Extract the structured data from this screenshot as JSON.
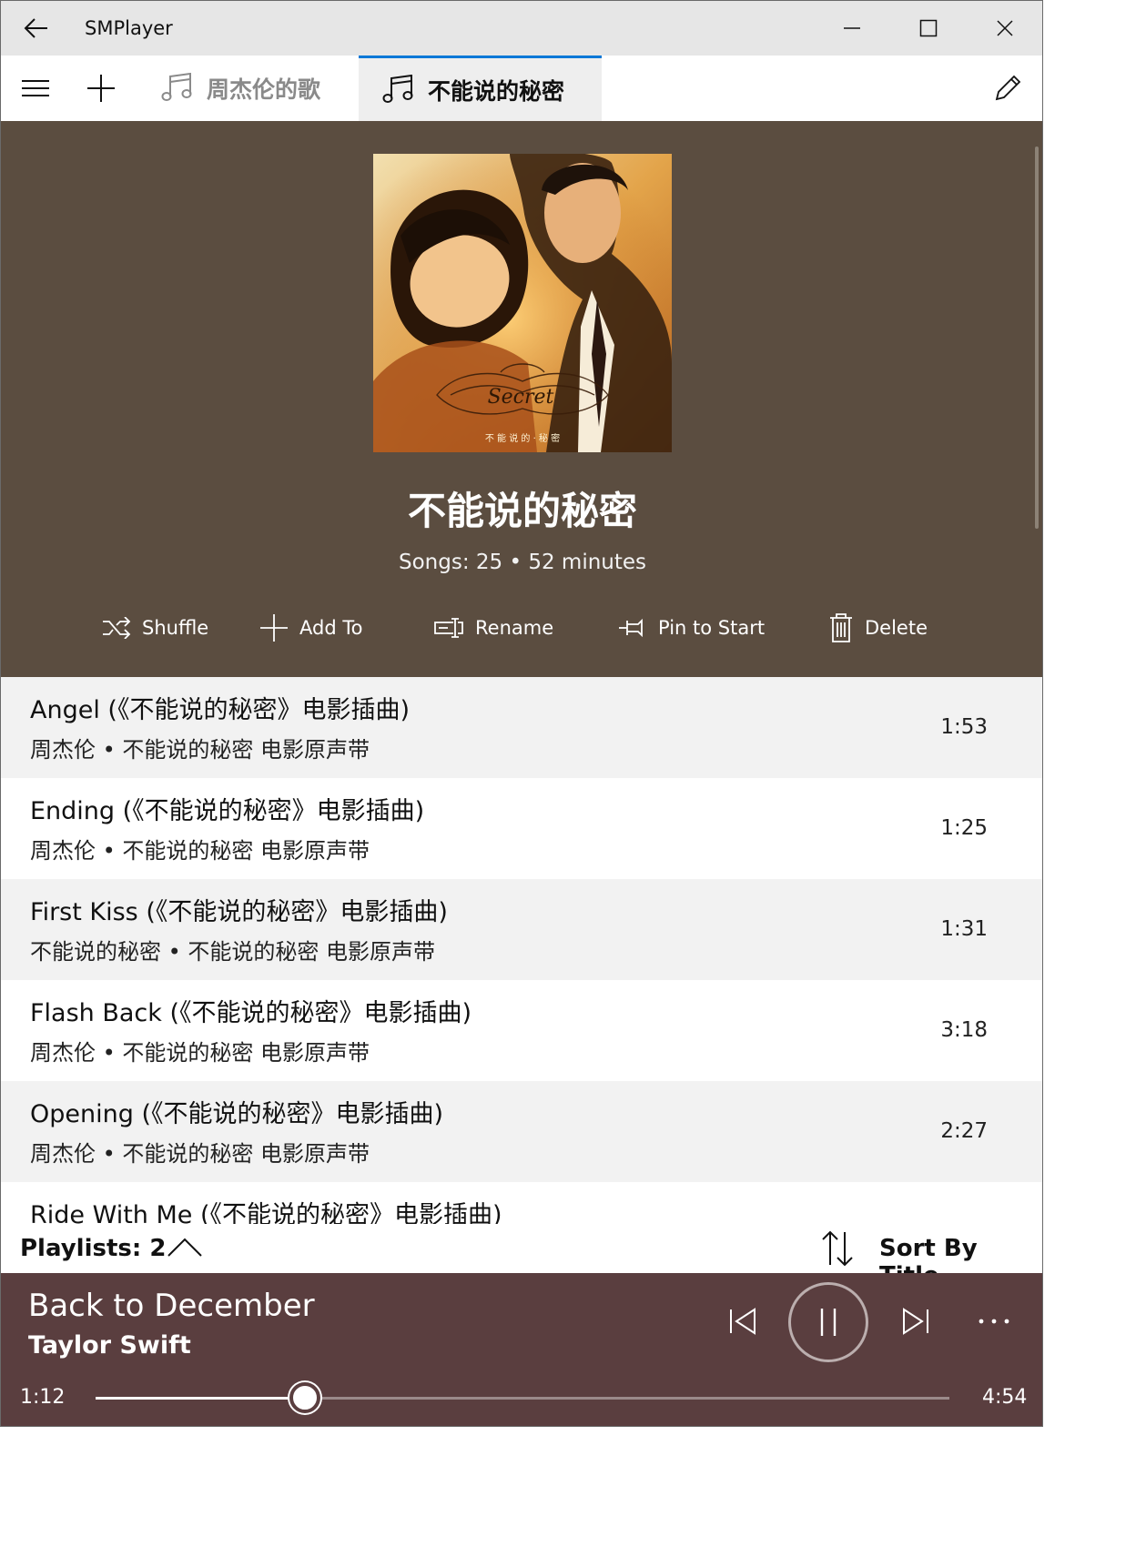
{
  "window": {
    "title": "SMPlayer"
  },
  "tabs": [
    {
      "label": "周杰伦的歌",
      "active": false
    },
    {
      "label": "不能说的秘密",
      "active": true
    }
  ],
  "playlist": {
    "title": "不能说的秘密",
    "meta": "Songs: 25 • 52 minutes",
    "album_art_text": {
      "script": "Secret",
      "caption": "不 能 说 的 · 秘 密"
    },
    "actions": [
      {
        "label": "Shuffle",
        "icon": "shuffle-icon"
      },
      {
        "label": "Add To",
        "icon": "plus-icon"
      },
      {
        "label": "Rename",
        "icon": "rename-icon"
      },
      {
        "label": "Pin to Start",
        "icon": "pin-icon"
      },
      {
        "label": "Delete",
        "icon": "trash-icon"
      }
    ]
  },
  "songs": [
    {
      "title": "Angel (《不能说的秘密》电影插曲)",
      "subtitle": "周杰伦 • 不能说的秘密 电影原声带",
      "duration": "1:53"
    },
    {
      "title": "Ending (《不能说的秘密》电影插曲)",
      "subtitle": "周杰伦 • 不能说的秘密 电影原声带",
      "duration": "1:25"
    },
    {
      "title": "First Kiss (《不能说的秘密》电影插曲)",
      "subtitle": "不能说的秘密 • 不能说的秘密 电影原声带",
      "duration": "1:31"
    },
    {
      "title": "Flash Back (《不能说的秘密》电影插曲)",
      "subtitle": "周杰伦 • 不能说的秘密 电影原声带",
      "duration": "3:18"
    },
    {
      "title": "Opening (《不能说的秘密》电影插曲)",
      "subtitle": "周杰伦 • 不能说的秘密 电影原声带",
      "duration": "2:27"
    },
    {
      "title": "Ride With Me (《不能说的秘密》电影插曲)",
      "subtitle": "",
      "duration": ""
    }
  ],
  "footer": {
    "playlists_label": "Playlists: 2",
    "sort_label": "Sort By Title"
  },
  "now_playing": {
    "title": "Back to December",
    "artist": "Taylor Swift",
    "elapsed": "1:12",
    "total": "4:54",
    "progress": 0.245
  },
  "colors": {
    "header_bg": "#5b4d40",
    "player_bg": "#5a3e3f",
    "accent": "#0078d7"
  }
}
